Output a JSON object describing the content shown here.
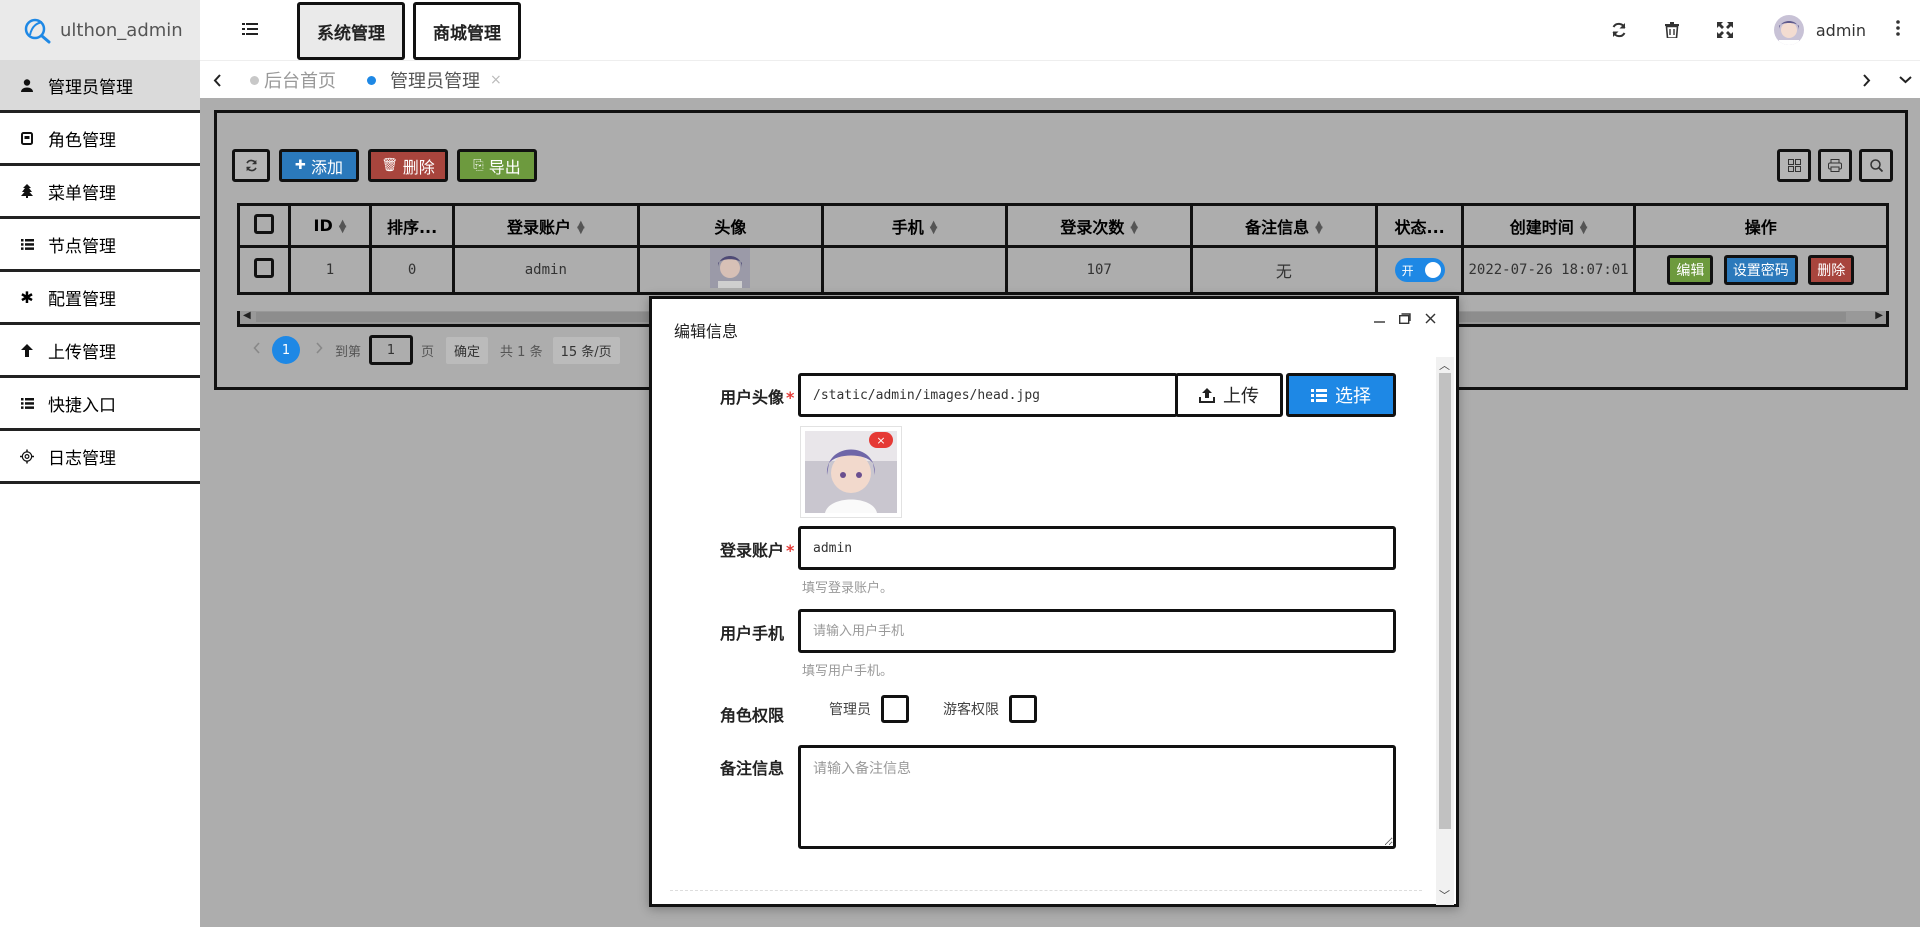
{
  "app": {
    "title": "ulthon_admin"
  },
  "sidebar": {
    "items": [
      {
        "label": "管理员管理",
        "icon": "user-icon"
      },
      {
        "label": "角色管理",
        "icon": "role-icon"
      },
      {
        "label": "菜单管理",
        "icon": "tree-icon"
      },
      {
        "label": "节点管理",
        "icon": "list-icon"
      },
      {
        "label": "配置管理",
        "icon": "asterisk-icon"
      },
      {
        "label": "上传管理",
        "icon": "arrow-up-icon"
      },
      {
        "label": "快捷入口",
        "icon": "list-icon"
      },
      {
        "label": "日志管理",
        "icon": "gear-outline-icon"
      }
    ]
  },
  "header": {
    "tabs": [
      {
        "label": "系统管理"
      },
      {
        "label": "商城管理"
      }
    ],
    "user": "admin"
  },
  "tabstrip": {
    "tabs": [
      {
        "label": "后台首页"
      },
      {
        "label": "管理员管理",
        "close": "×"
      }
    ]
  },
  "toolbar": {
    "add": "添加",
    "delete": "删除",
    "export": "导出"
  },
  "table": {
    "headers": {
      "id": "ID",
      "sort": "排序...",
      "account": "登录账户",
      "avatar": "头像",
      "phone": "手机",
      "logins": "登录次数",
      "remark": "备注信息",
      "status": "状态...",
      "created": "创建时间",
      "ops": "操作"
    },
    "rows": [
      {
        "id": "1",
        "sort": "0",
        "account": "admin",
        "phone": "",
        "logins": "107",
        "remark": "无",
        "status": "开",
        "created": "2022-07-26 18:07:01"
      }
    ],
    "ops": {
      "edit": "编辑",
      "password": "设置密码",
      "delete": "删除"
    }
  },
  "pager": {
    "page": "1",
    "goto": "到第",
    "input": "1",
    "unit": "页",
    "confirm": "确定",
    "total": "共 1 条",
    "size": "15 条/页"
  },
  "modal": {
    "title": "编辑信息",
    "fields": {
      "avatar": {
        "label": "用户头像",
        "value": "/static/admin/images/head.jpg",
        "upload": "上传",
        "select": "选择",
        "remove": "×"
      },
      "account": {
        "label": "登录账户",
        "value": "admin",
        "help": "填写登录账户。"
      },
      "phone": {
        "label": "用户手机",
        "placeholder": "请输入用户手机",
        "help": "填写用户手机。"
      },
      "roles": {
        "label": "角色权限",
        "options": [
          {
            "label": "管理员"
          },
          {
            "label": "游客权限"
          }
        ]
      },
      "remark": {
        "label": "备注信息",
        "placeholder": "请输入备注信息"
      }
    },
    "required_mark": "*"
  },
  "colors": {
    "primary": "#1e88e5",
    "danger": "#e53935",
    "success": "#4caf50",
    "warning": "#f5a623"
  }
}
